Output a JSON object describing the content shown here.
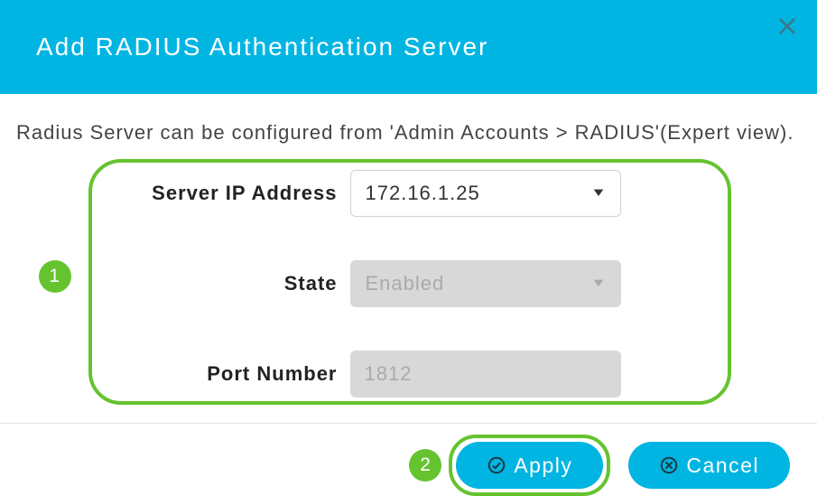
{
  "dialog": {
    "title": "Add RADIUS Authentication Server",
    "info_text": "Radius Server can be configured from 'Admin Accounts > RADIUS'(Expert view)."
  },
  "form": {
    "server_ip": {
      "label": "Server IP Address",
      "value": "172.16.1.25"
    },
    "state": {
      "label": "State",
      "value": "Enabled"
    },
    "port": {
      "label": "Port Number",
      "value": "1812"
    }
  },
  "buttons": {
    "apply": "Apply",
    "cancel": "Cancel"
  },
  "annotations": {
    "step1": "1",
    "step2": "2"
  }
}
